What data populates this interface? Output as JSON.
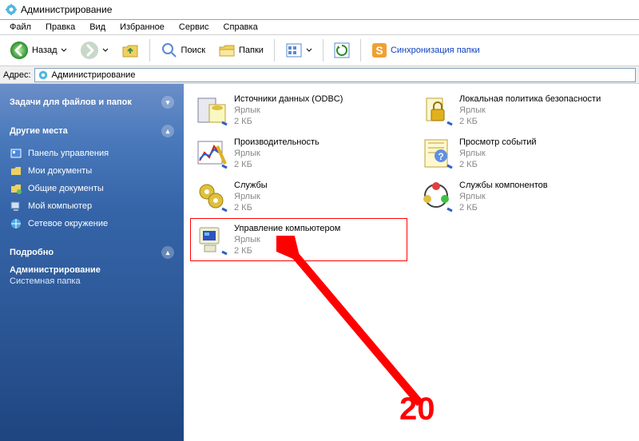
{
  "titlebar": {
    "title": "Администрирование"
  },
  "menubar": {
    "items": [
      "Файл",
      "Правка",
      "Вид",
      "Избранное",
      "Сервис",
      "Справка"
    ]
  },
  "toolbar": {
    "back_label": "Назад",
    "search_label": "Поиск",
    "folders_label": "Папки",
    "sync_label": "Синхронизация папки"
  },
  "address": {
    "label": "Адрес:",
    "value": "Администрирование"
  },
  "sidebar": {
    "tasks_header": "Задачи для файлов и папок",
    "places_header": "Другие места",
    "places": [
      "Панель управления",
      "Мои документы",
      "Общие документы",
      "Мой компьютер",
      "Сетевое окружение"
    ],
    "details_header": "Подробно",
    "details_title": "Администрирование",
    "details_info": "Системная папка"
  },
  "files": [
    {
      "name": "Источники данных (ODBC)",
      "type": "Ярлык",
      "size": "2 КБ",
      "highlighted": false
    },
    {
      "name": "Локальная политика безопасности",
      "type": "Ярлык",
      "size": "2 КБ",
      "highlighted": false
    },
    {
      "name": "Производительность",
      "type": "Ярлык",
      "size": "2 КБ",
      "highlighted": false
    },
    {
      "name": "Просмотр событий",
      "type": "Ярлык",
      "size": "2 КБ",
      "highlighted": false
    },
    {
      "name": "Службы",
      "type": "Ярлык",
      "size": "2 КБ",
      "highlighted": false
    },
    {
      "name": "Службы компонентов",
      "type": "Ярлык",
      "size": "2 КБ",
      "highlighted": false
    },
    {
      "name": "Управление компьютером",
      "type": "Ярлык",
      "size": "2 КБ",
      "highlighted": true
    }
  ],
  "annotation": {
    "number": "20"
  },
  "icons": {
    "app": "gear-icon",
    "sidebar_places": [
      "control-panel-icon",
      "documents-icon",
      "shared-docs-icon",
      "computer-icon",
      "network-icon"
    ],
    "files": [
      "odbc-icon",
      "security-icon",
      "performance-icon",
      "event-viewer-icon",
      "services-icon",
      "component-services-icon",
      "computer-mgmt-icon"
    ]
  },
  "colors": {
    "highlight_border": "#ff0000",
    "sidebar_top": "#6b8ec8",
    "sidebar_bottom": "#1f4580",
    "annotation": "#ff0000"
  }
}
